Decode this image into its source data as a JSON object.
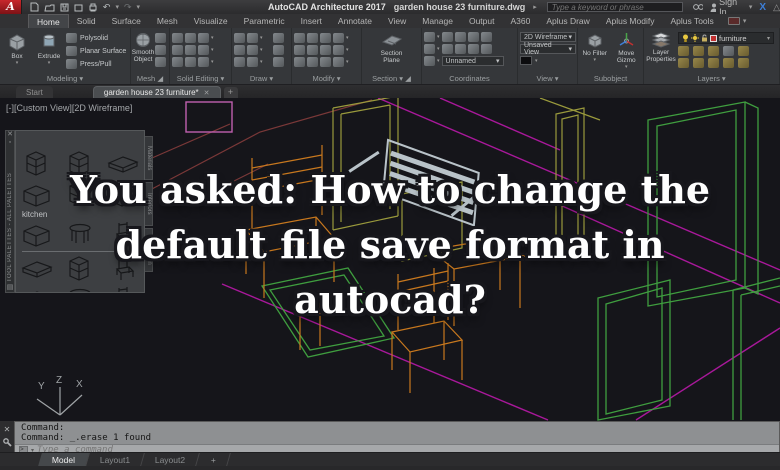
{
  "title_bar": {
    "logo_letter": "A",
    "app_title": "AutoCAD Architecture 2017",
    "document_title": "garden house 23 furniture.dwg",
    "search_placeholder": "Type a keyword or phrase",
    "sign_in_label": "Sign In"
  },
  "ribbon_tabs": [
    "Home",
    "Solid",
    "Surface",
    "Mesh",
    "Visualize",
    "Parametric",
    "Insert",
    "Annotate",
    "View",
    "Manage",
    "Output",
    "A360",
    "Aplus Draw",
    "Aplus Modify",
    "Aplus Tools"
  ],
  "ribbon": {
    "modeling": {
      "label": "Modeling",
      "box_label": "Box",
      "extrude_label": "Extrude",
      "polysolid_label": "Polysolid",
      "planar_surface_label": "Planar Surface",
      "press_pull_label": "Press/Pull"
    },
    "mesh": {
      "label": "Mesh",
      "smooth_object_label": "Smooth Object"
    },
    "solid_editing": {
      "label": "Solid Editing"
    },
    "draw": {
      "label": "Draw"
    },
    "modify": {
      "label": "Modify"
    },
    "section": {
      "label": "Section",
      "section_plane_label": "Section Plane"
    },
    "coordinates": {
      "label": "Coordinates",
      "ucs_name": "Unnamed"
    },
    "view": {
      "label": "View",
      "visual_style": "2D Wireframe",
      "named_view": "Unsaved View"
    },
    "subobject": {
      "label": "Subobject",
      "no_filter_label": "No Filter",
      "move_gizmo_label": "Move Gizmo"
    },
    "layers": {
      "label": "Layers",
      "layer_properties_label": "Layer Properties",
      "current_layer": "furniture"
    }
  },
  "document_tabs": {
    "start_label": "Start",
    "active_label": "garden house 23 furniture*",
    "new_label": "+"
  },
  "viewport": {
    "label": "[-][Custom View][2D Wireframe]",
    "overlay_lines": [
      "You asked: How to change the",
      "default file save format in",
      "autocad?"
    ],
    "axis": {
      "x": "X",
      "y": "Y",
      "z": "Z"
    }
  },
  "tool_palette": {
    "title": "TOOL PALETTES - ALL PALETTES",
    "group_label": "kitchen",
    "side_tabs": [
      "Materials",
      "Interiors",
      "Annotation"
    ]
  },
  "command_line": {
    "history": [
      "Command:",
      "Command: _.erase 1 found"
    ],
    "placeholder": "Type a command"
  },
  "layout_tabs": {
    "model": "Model",
    "layout1": "Layout1",
    "layout2": "Layout2",
    "new": "+"
  },
  "wireframe_colors": {
    "magenta": "#a8189a",
    "green": "#3f9e3f",
    "olive": "#9a9a3c",
    "orange": "#c8781e",
    "dark_red": "#7a3838",
    "grey_object": "#b9c3c9",
    "background": "#15151a"
  }
}
